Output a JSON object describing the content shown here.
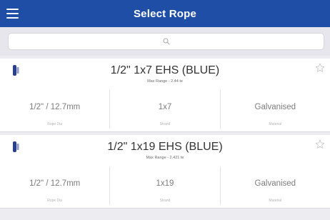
{
  "header": {
    "title": "Select Rope"
  },
  "search": {
    "value": "",
    "placeholder": ""
  },
  "ropes": [
    {
      "name": "1/2\" 1x7 EHS (BLUE)",
      "subtitle": "Max Range - 2.44 te",
      "specs": [
        {
          "value": "1/2\" / 12.7mm",
          "label": "Rope Dia"
        },
        {
          "value": "1x7",
          "label": "Strand"
        },
        {
          "value": "Galvanised",
          "label": "Material"
        }
      ]
    },
    {
      "name": "1/2\" 1x19 EHS (BLUE)",
      "subtitle": "Max Range - 2.421 te",
      "specs": [
        {
          "value": "1/2\" / 12.7mm",
          "label": "Rope Dia"
        },
        {
          "value": "1x19",
          "label": "Strand"
        },
        {
          "value": "Galvanised",
          "label": "Material"
        }
      ]
    }
  ],
  "colors": {
    "navbar": "#1f4ea6",
    "background": "#ececf1",
    "rope_badge": "#2a3f8f"
  },
  "icons": [
    "hamburger-menu-icon",
    "search-icon",
    "rope-color-badge-icon",
    "star-outline-icon"
  ]
}
